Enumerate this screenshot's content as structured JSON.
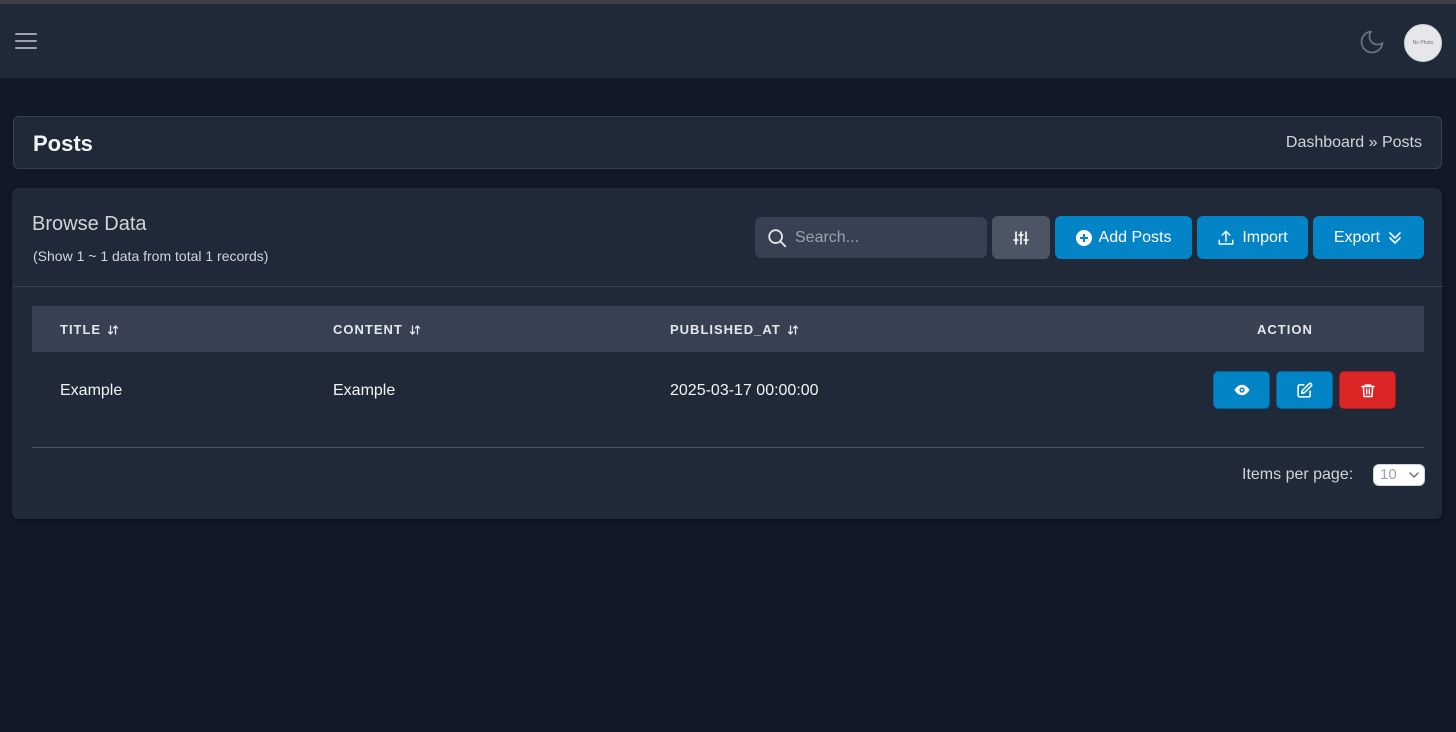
{
  "navbar": {
    "menu_icon": "hamburger-icon",
    "theme_icon": "moon-icon",
    "avatar_text": "No Photo"
  },
  "header": {
    "title": "Posts",
    "breadcrumb": {
      "parent": "Dashboard",
      "separator": "»",
      "current": "Posts"
    }
  },
  "browse": {
    "title": "Browse Data",
    "subtitle": "(Show 1 ~ 1 data from total 1 records)"
  },
  "toolbar": {
    "search_placeholder": "Search...",
    "search_value": "",
    "filter_icon": "sliders-icon",
    "add_label": "Add Posts",
    "import_label": "Import",
    "export_label": "Export"
  },
  "table": {
    "columns": [
      {
        "label": "TITLE",
        "sortable": true
      },
      {
        "label": "CONTENT",
        "sortable": true
      },
      {
        "label": "PUBLISHED_AT",
        "sortable": true
      },
      {
        "label": "ACTION",
        "sortable": false
      }
    ],
    "rows": [
      {
        "title": "Example",
        "content": "Example",
        "published_at": "2025-03-17 00:00:00"
      }
    ],
    "actions": [
      "view",
      "edit",
      "delete"
    ]
  },
  "pagination": {
    "items_per_page_label": "Items per page:",
    "items_per_page_value": "10"
  },
  "colors": {
    "background": "#111827",
    "card": "#1f2937",
    "primary": "#0284c7",
    "danger": "#dc2626",
    "secondary": "#4b5563"
  }
}
